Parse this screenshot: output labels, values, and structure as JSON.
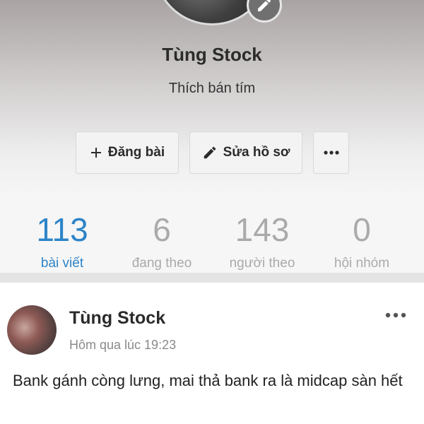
{
  "profile": {
    "name": "Tùng Stock",
    "bio": "Thích bán tím"
  },
  "actions": {
    "post_label": "Đăng bài",
    "edit_label": "Sửa hồ sơ"
  },
  "icons": {
    "edit_avatar": "pencil-icon",
    "post": "plus-icon",
    "edit_profile": "pencil-icon",
    "more": "more-horizontal-icon"
  },
  "stats": [
    {
      "value": "113",
      "label": "bài viết",
      "active": true
    },
    {
      "value": "6",
      "label": "đang theo",
      "active": false
    },
    {
      "value": "143",
      "label": "người theo",
      "active": false
    },
    {
      "value": "0",
      "label": "hội nhóm",
      "active": false
    }
  ],
  "post": {
    "author": "Tùng Stock",
    "timestamp": "Hôm qua lúc 19:23",
    "text": "Bank gánh còng lưng, mai thả bank ra là midcap sàn hết"
  },
  "colors": {
    "accent": "#2d84c8",
    "muted": "#aaaaaa",
    "text": "#2b2b2b"
  }
}
